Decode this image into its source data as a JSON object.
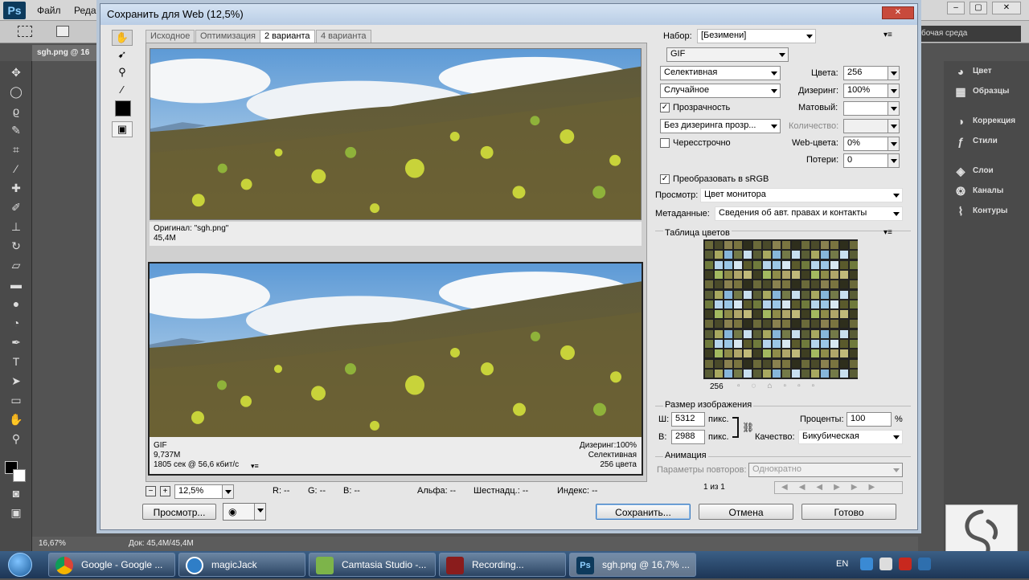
{
  "ps": {
    "logo": "Ps",
    "menu": [
      "Файл",
      "Редак"
    ],
    "workspace": "бочая среда",
    "doc_tab": "sgh.png @ 16",
    "status_zoom": "16,67%",
    "status_doc": "Док: 45,4M/45,4M"
  },
  "dialog": {
    "title": "Сохранить для Web (12,5%)",
    "tabs": [
      "Исходное",
      "Оптимизация",
      "2 варианта",
      "4 варианта"
    ],
    "original": {
      "line1": "Оригинал: \"sgh.png\"",
      "line2": "45,4M"
    },
    "optimized": {
      "format": "GIF",
      "size": "9,737M",
      "time": "1805 сек @ 56,6 кбит/с",
      "dither_info": "Дизеринг:100%",
      "palette_info": "Селективная",
      "colors_info": "256 цвета"
    },
    "zoom": "12,5%",
    "readout": {
      "r": "R: --",
      "g": "G: --",
      "b": "B: --",
      "alpha": "Альфа: --",
      "hex": "Шестнадц.: --",
      "index": "Индекс: --"
    },
    "buttons": {
      "preview": "Просмотр...",
      "save": "Сохранить...",
      "cancel": "Отмена",
      "done": "Готово"
    }
  },
  "settings": {
    "preset_label": "Набор:",
    "preset_value": "[Безимени]",
    "format": "GIF",
    "reduction": "Селективная",
    "dither_algo": "Случайное",
    "colors_label": "Цвета:",
    "colors_value": "256",
    "dither_label": "Дизеринг:",
    "dither_value": "100%",
    "transparency_label": "Прозрачность",
    "matte_label": "Матовый:",
    "trans_dither": "Без дизеринга прозр...",
    "amount_label": "Количество:",
    "interlaced_label": "Чересстрочно",
    "websnap_label": "Web-цвета:",
    "websnap_value": "0%",
    "lossy_label": "Потери:",
    "lossy_value": "0",
    "srgb_label": "Преобразовать в sRGB",
    "preview_label": "Просмотр:",
    "preview_value": "Цвет монитора",
    "meta_label": "Метаданные:",
    "meta_value": "Сведения об авт. правах и контакты",
    "color_table_title": "Таблица цветов",
    "color_count": "256",
    "imgsize_title": "Размер изображения",
    "w_label": "Ш:",
    "w_value": "5312",
    "h_label": "В:",
    "h_value": "2988",
    "px": "пикс.",
    "percent_label": "Проценты:",
    "percent_value": "100",
    "percent_sign": "%",
    "quality_label": "Качество:",
    "quality_value": "Бикубическая",
    "anim_title": "Анимация",
    "loop_label": "Параметры повторов:",
    "loop_value": "Однократно",
    "frame_counter": "1 из 1"
  },
  "right_panel": {
    "items": [
      "Цвет",
      "Образцы",
      "Коррекция",
      "Стили",
      "Слои",
      "Каналы",
      "Контуры"
    ]
  },
  "taskbar": {
    "items": [
      "Google - Google ...",
      "magicJack",
      "Camtasia Studio -...",
      "Recording...",
      "sgh.png @ 16,7% ..."
    ],
    "lang": "EN"
  },
  "colors": {
    "accent": "#3d7bbf",
    "palette": [
      "#6b6a3a",
      "#8e8c4a",
      "#5a5a2c",
      "#a8a860",
      "#7a7440",
      "#3e3e22",
      "#9bc6e6",
      "#c8dff0",
      "#4a4a2a",
      "#b0a66a",
      "#6f7a3c",
      "#87b6da",
      "#2e2e1c",
      "#a3b960",
      "#d7e7f2",
      "#595d35",
      "#8a8150",
      "#c0b97a",
      "#b5d4ec",
      "#747a48"
    ]
  }
}
